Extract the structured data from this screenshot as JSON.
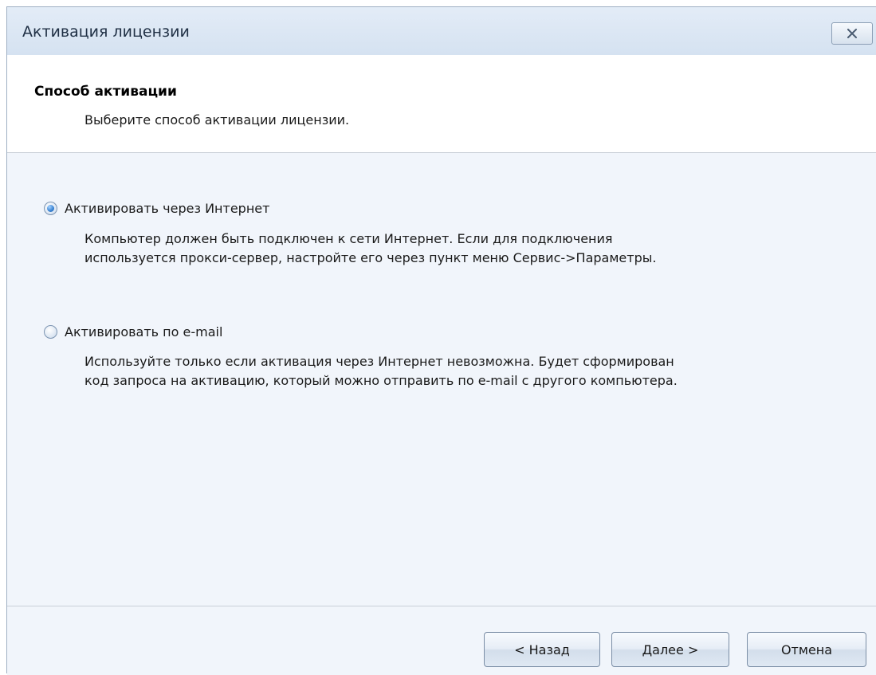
{
  "window": {
    "title": "Активация лицензии",
    "close_label": "Close"
  },
  "header": {
    "title": "Способ активации",
    "subtitle": "Выберите способ активации лицензии."
  },
  "options": [
    {
      "label": "Активировать через Интернет",
      "selected": true,
      "description_line1": "Компьютер должен быть подключен к сети Интернет. Если для подключения",
      "description_line2": "используется прокси-сервер, настройте его через пункт меню Сервис->Параметры."
    },
    {
      "label": "Активировать по e-mail",
      "selected": false,
      "description_line1": "Используйте только если активация через Интернет невозможна. Будет сформирован",
      "description_line2": "код запроса на активацию, который можно отправить по e-mail с другого компьютера."
    }
  ],
  "buttons": {
    "back": "< Назад",
    "next": "Далее >",
    "cancel": "Отмена"
  },
  "colors": {
    "background": "#f1f5fb",
    "header_background": "#ffffff",
    "titlebar": "#dce7f4",
    "radio_selected": "#3f87d6"
  },
  "icons": {
    "close": "close-icon",
    "radio_selected": "radio-selected-icon",
    "radio_unselected": "radio-unselected-icon"
  }
}
